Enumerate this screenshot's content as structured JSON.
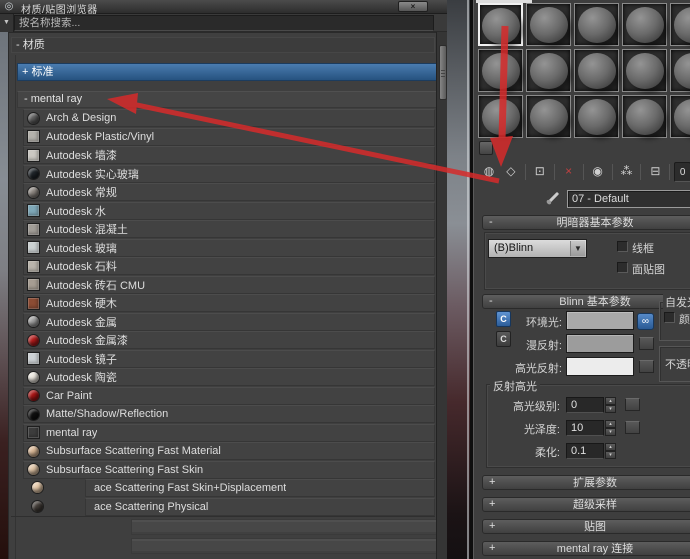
{
  "browser": {
    "title": "材质/贴图浏览器",
    "logo_glyph": "◎",
    "close_glyph": "×",
    "filter_arrow": "▼",
    "search_placeholder": "按名称搜索...",
    "materials_header": "- 材质",
    "standard_row": "+ 标准",
    "mentalray_row": "- mental ray",
    "items": [
      {
        "label": "Arch & Design",
        "icon": "sphere",
        "color": "#5f5f5f"
      },
      {
        "label": "Autodesk Plastic/Vinyl",
        "icon": "square",
        "color": "#b5b3ad"
      },
      {
        "label": "Autodesk 墙漆",
        "icon": "square",
        "color": "#cbc9c3"
      },
      {
        "label": "Autodesk 实心玻璃",
        "icon": "sphere",
        "color": "#20262b"
      },
      {
        "label": "Autodesk 常规",
        "icon": "sphere",
        "color": "#8d8781"
      },
      {
        "label": "Autodesk 水",
        "icon": "square",
        "color": "#7fa8b8"
      },
      {
        "label": "Autodesk 混凝土",
        "icon": "square",
        "color": "#a29e98"
      },
      {
        "label": "Autodesk 玻璃",
        "icon": "square",
        "color": "#ccd2d3"
      },
      {
        "label": "Autodesk 石料",
        "icon": "square",
        "color": "#bab5ac"
      },
      {
        "label": "Autodesk 砖石 CMU",
        "icon": "square",
        "color": "#a69d92"
      },
      {
        "label": "Autodesk 硬木",
        "icon": "square",
        "color": "#8c4c34"
      },
      {
        "label": "Autodesk 金属",
        "icon": "sphere",
        "color": "#a0a0a0"
      },
      {
        "label": "Autodesk 金属漆",
        "icon": "sphere",
        "color": "#b41c1c"
      },
      {
        "label": "Autodesk 镜子",
        "icon": "square",
        "color": "#ced3d6"
      },
      {
        "label": "Autodesk 陶瓷",
        "icon": "sphere",
        "color": "#ece8df"
      },
      {
        "label": "Car Paint",
        "icon": "sphere",
        "color": "#a81414"
      },
      {
        "label": "Matte/Shadow/Reflection",
        "icon": "sphere",
        "color": "#101010"
      },
      {
        "label": "mental ray",
        "icon": "square",
        "color": "#3d3d3d"
      },
      {
        "label": "Subsurface Scattering Fast Material",
        "icon": "sphere",
        "color": "#d9b795"
      },
      {
        "label": "Subsurface Scattering Fast Skin",
        "icon": "sphere",
        "color": "#dfc3a4"
      },
      {
        "label": "ace Scattering Fast Skin+Displacement",
        "icon": "sphere",
        "color": "#e6c9a9",
        "indent": true
      },
      {
        "label": "ace Scattering Physical",
        "icon": "sphere",
        "color": "#433d38",
        "indent": true
      }
    ]
  },
  "editor": {
    "sample_slots": {
      "rows": 3,
      "cols": 5,
      "selected": 0
    },
    "toolbar": [
      {
        "name": "get-material-icon",
        "glyph": "◍"
      },
      {
        "name": "put-material-to-scene-icon",
        "glyph": "◇"
      },
      {
        "type": "divider"
      },
      {
        "name": "assign-material-to-selection-icon",
        "glyph": "⊡"
      },
      {
        "type": "divider"
      },
      {
        "name": "reset-material-icon",
        "glyph": "×",
        "color": "#c24040"
      },
      {
        "type": "divider"
      },
      {
        "name": "make-material-copy-icon",
        "glyph": "◉"
      },
      {
        "type": "divider"
      },
      {
        "name": "make-unique-icon",
        "glyph": "⁂"
      },
      {
        "type": "divider"
      },
      {
        "name": "put-to-library-icon",
        "glyph": "⊟"
      },
      {
        "type": "divider"
      },
      {
        "name": "material-id-channel-button",
        "glyph": "0",
        "sunken": true
      }
    ],
    "name_field": {
      "value": "07 - Default"
    },
    "rollout_shader": {
      "collapse_glyph": "-",
      "title": "明暗器基本参数",
      "shader_dropdown": "(B)Blinn",
      "dropdown_arrow": "▼",
      "wire_label": "线框",
      "facemap_label": "面贴图"
    },
    "rollout_blinn": {
      "collapse_glyph": "-",
      "title": "Blinn 基本参数",
      "link_glyph": "C",
      "lock_glyph": "∞",
      "ambient_label": "环境光:",
      "diffuse_label": "漫反射:",
      "specular_label": "高光反射:",
      "ambient_color": "#a9a9a9",
      "diffuse_color": "#9c9c9c",
      "specular_color": "#ececec",
      "selfillum_label": "自发光",
      "color_label": "颜色",
      "opacity_label": "不透明度",
      "highlights": {
        "title": "反射高光",
        "spin_up": "▴",
        "spin_down": "▾",
        "rows": [
          {
            "label": "高光级别:",
            "value": "0",
            "map": true
          },
          {
            "label": "光泽度:",
            "value": "10",
            "map": true
          },
          {
            "label": "柔化:",
            "value": "0.1",
            "map": false
          }
        ]
      }
    },
    "collapsed_rollouts": [
      {
        "expand_glyph": "+",
        "title": "扩展参数"
      },
      {
        "expand_glyph": "+",
        "title": "超级采样"
      },
      {
        "expand_glyph": "+",
        "title": "贴图"
      },
      {
        "expand_glyph": "+",
        "title": "mental ray 连接"
      }
    ],
    "annotation_color": "#d62b2b"
  }
}
